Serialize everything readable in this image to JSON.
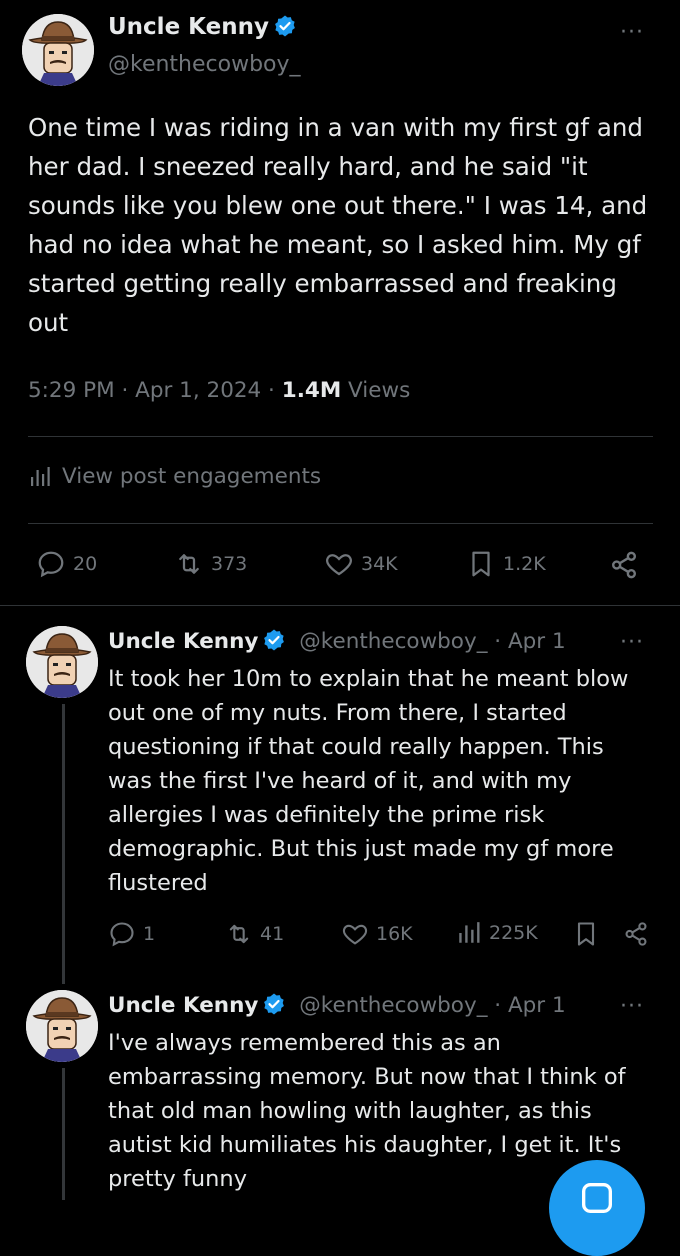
{
  "main_tweet": {
    "name": "Uncle Kenny",
    "handle": "@kenthecowboy_",
    "text": "One time I was riding in a van with my first gf and her dad. I sneezed really hard, and he said \"it sounds like you blew one out there.\" I was 14, and had no idea what he meant, so I asked him. My gf started getting really embarrassed and freaking out",
    "time": "5:29 PM · Apr 1, 2024 · ",
    "views_count": "1.4M",
    "views_label": " Views",
    "engagements_label": "View post engagements",
    "replies": "20",
    "reposts": "373",
    "likes": "34K",
    "bookmarks": "1.2K",
    "more_icon": "more-dots-icon"
  },
  "replies": [
    {
      "name": "Uncle Kenny",
      "handle": "@kenthecowboy_",
      "date": " · Apr 1",
      "text": "It took her 10m to explain that he meant blow out one of my nuts. From there, I started questioning if that could really happen. This was the first I've heard of it, and with my allergies I was definitely the prime risk demographic. But this just made my gf more flustered",
      "replies": "1",
      "reposts": "41",
      "likes": "16K",
      "views": "225K"
    },
    {
      "name": "Uncle Kenny",
      "handle": "@kenthecowboy_",
      "date": " · Apr 1",
      "text": "I've always remembered this as an embarrassing memory. But now that I think of that old man howling with laughter, as this autist kid humiliates his daughter, I get it. It's pretty funny"
    }
  ],
  "colors": {
    "background": "#000000",
    "text": "#e7e9ea",
    "muted": "#71767b",
    "divider": "#2f3336",
    "verified": "#1d9bf0",
    "accent": "#1d9bf0"
  },
  "icons": [
    "verified-badge-icon",
    "more-dots-icon",
    "reply-icon",
    "repost-icon",
    "like-icon",
    "bookmark-icon",
    "share-icon",
    "analytics-icon",
    "compose-icon"
  ]
}
